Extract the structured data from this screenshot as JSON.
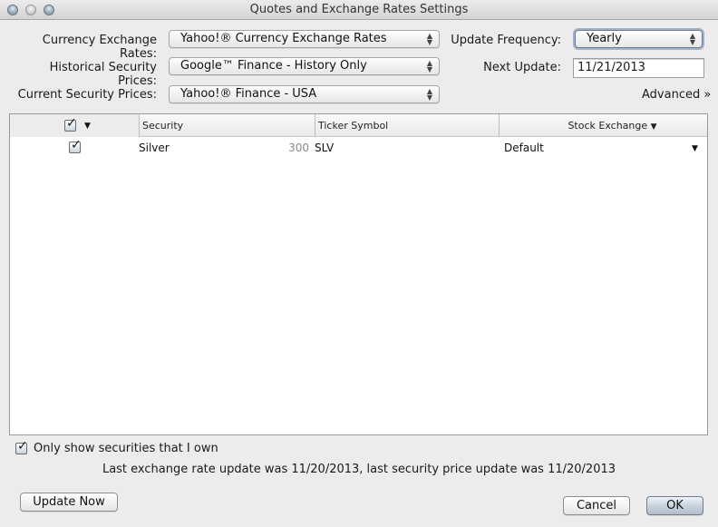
{
  "window": {
    "title": "Quotes and Exchange Rates Settings",
    "controls": [
      "close",
      "minimize",
      "zoom"
    ]
  },
  "settings": {
    "currency_exchange_rates": {
      "label": "Currency Exchange Rates:",
      "value": "Yahoo!® Currency Exchange Rates"
    },
    "historical_security_prices": {
      "label": "Historical Security Prices:",
      "value": "Google™ Finance - History Only"
    },
    "current_security_prices": {
      "label": "Current Security Prices:",
      "value": "Yahoo!® Finance - USA"
    },
    "update_frequency": {
      "label": "Update Frequency:",
      "value": "Yearly"
    },
    "next_update": {
      "label": "Next Update:",
      "value": "11/21/2013"
    },
    "advanced_link": "Advanced »"
  },
  "table": {
    "header_checkbox_checked": true,
    "columns": [
      "Security",
      "Ticker Symbol",
      "Stock Exchange"
    ],
    "rows": [
      {
        "checked": true,
        "security": "Silver",
        "shares": "300",
        "ticker": "SLV",
        "exchange": "Default"
      }
    ]
  },
  "footer": {
    "only_owned_label": "Only show securities that I own",
    "only_owned_checked": true,
    "status": "Last exchange rate update was 11/20/2013, last security price update was 11/20/2013",
    "update_now": "Update Now",
    "cancel": "Cancel",
    "ok": "OK"
  },
  "glyphs": {
    "check": "✓",
    "dropdown": "▼",
    "stepper_up": "▲",
    "stepper_down": "▼"
  }
}
